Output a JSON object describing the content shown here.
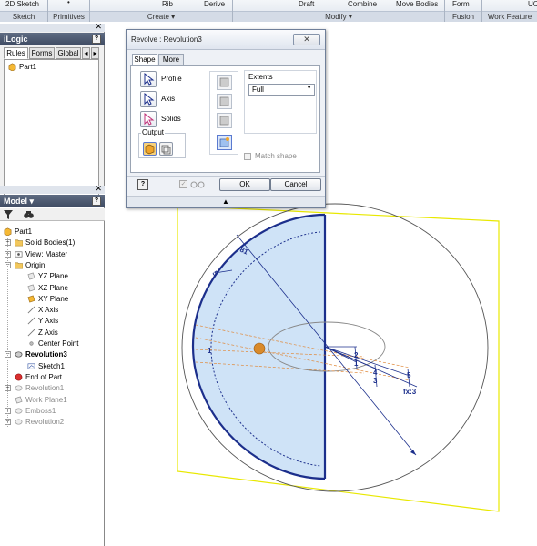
{
  "ribbon": {
    "sketch2d": "2D Sketch",
    "rib": "Rib",
    "derive": "Derive",
    "draft": "Draft",
    "combine": "Combine",
    "move_bodies": "Move Bodies",
    "form": "Form",
    "ucs": "UC",
    "groups": [
      "Sketch",
      "Primitives",
      "Create ▾",
      "Modify ▾",
      "Fusion",
      "Work Feature"
    ]
  },
  "ilogic": {
    "title": "iLogic",
    "tabs": [
      "Rules",
      "Forms",
      "Global"
    ],
    "items": [
      "Part1"
    ]
  },
  "model": {
    "title": "Model ▾",
    "tree": [
      {
        "label": "Part1"
      },
      {
        "label": "Solid Bodies(1)"
      },
      {
        "label": "View: Master"
      },
      {
        "label": "Origin"
      },
      {
        "label": "YZ Plane"
      },
      {
        "label": "XZ Plane"
      },
      {
        "label": "XY Plane"
      },
      {
        "label": "X Axis"
      },
      {
        "label": "Y Axis"
      },
      {
        "label": "Z Axis"
      },
      {
        "label": "Center Point"
      },
      {
        "label": "Revolution3"
      },
      {
        "label": "Sketch1"
      },
      {
        "label": "End of Part"
      },
      {
        "label": "Revolution1"
      },
      {
        "label": "Work Plane1"
      },
      {
        "label": "Emboss1"
      },
      {
        "label": "Revolution2"
      }
    ]
  },
  "dialog": {
    "title": "Revolve : Revolution3",
    "tabs": [
      "Shape",
      "More"
    ],
    "profile": "Profile",
    "axis": "Axis",
    "solids": "Solids",
    "output": "Output",
    "extents": "Extents",
    "extents_value": "Full",
    "match_shape": "Match shape",
    "ok": "OK",
    "cancel": "Cancel"
  },
  "sketch_dims": {
    "d1": "81",
    "d2": "5",
    "d3": "1",
    "d4": "4",
    "d5": "2",
    "d6": "1",
    "d7": "3",
    "d8": "5",
    "fx": "fx:3"
  },
  "colors": {
    "accent_blue": "#1c2f8c",
    "profile_fill": "#cfe3f7",
    "plane_yellow": "#e8e800",
    "panel_title": "#4a566d"
  }
}
